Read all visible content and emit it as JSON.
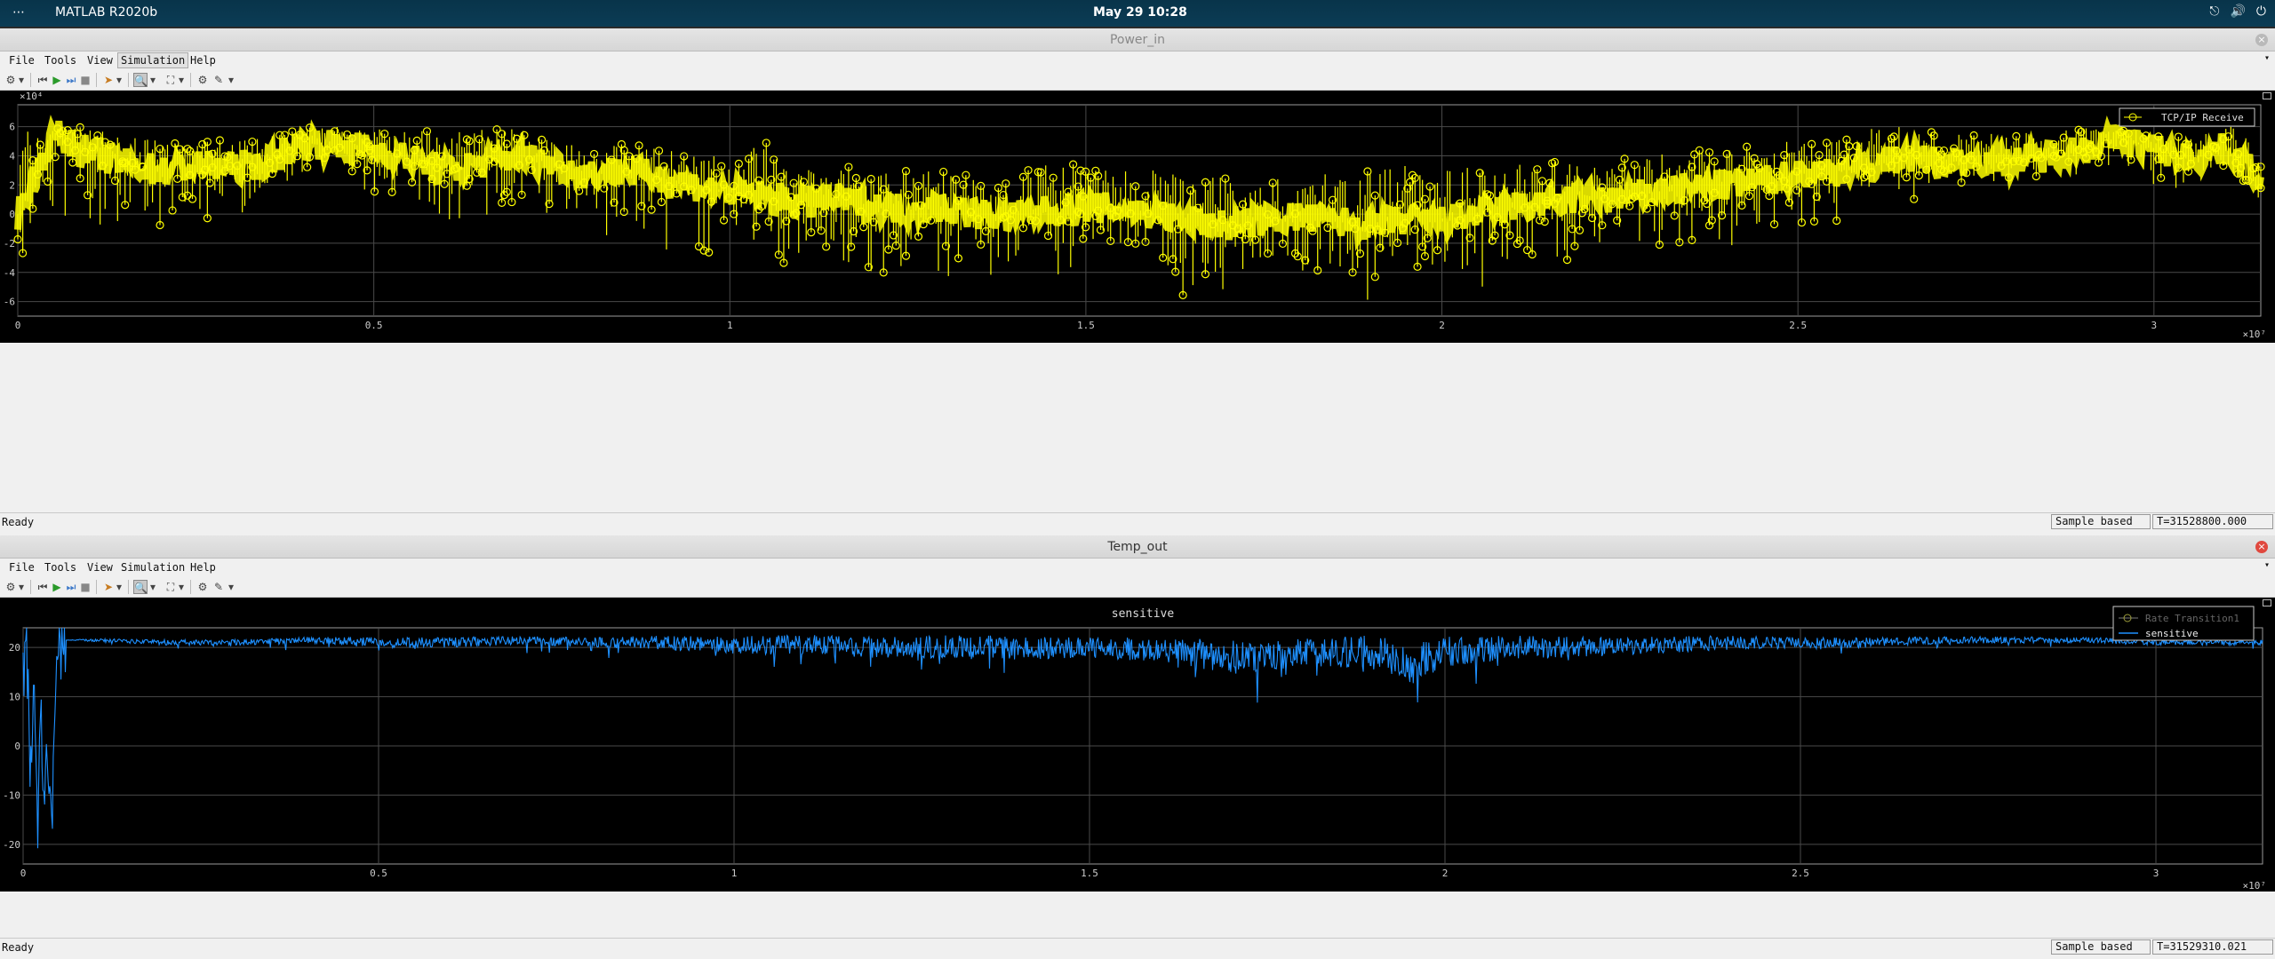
{
  "topbar": {
    "activities": "⋯",
    "app_name": "MATLAB R2020b",
    "clock": "May 29  10:28"
  },
  "scopes": [
    {
      "title": "Power_in",
      "menu": [
        "File",
        "Tools",
        "View",
        "Simulation",
        "Help"
      ],
      "status": {
        "ready": "Ready",
        "mode": "Sample based",
        "time": "T=31528800.000"
      }
    },
    {
      "title": "Temp_out",
      "plot_title": "sensitive",
      "menu": [
        "File",
        "Tools",
        "View",
        "Simulation",
        "Help"
      ],
      "status": {
        "ready": "Ready",
        "mode": "Sample based",
        "time": "T=31529310.021"
      }
    }
  ],
  "colors": {
    "signal_power": "#ffff00",
    "signal_temp": "#1e90ff",
    "axes_bg": "#000000",
    "grid": "#4a4a4a",
    "tick_text": "#cccccc"
  },
  "chart_data": [
    {
      "type": "scatter",
      "title": "",
      "xlabel": "",
      "ylabel": "",
      "x_exponent_label": "×10⁷",
      "y_exponent_label": "×10⁴",
      "xlim": [
        0,
        3.15
      ],
      "ylim": [
        -7,
        7.5
      ],
      "x_ticks": [
        "0",
        "0.5",
        "1",
        "1.5",
        "2",
        "2.5",
        "3"
      ],
      "x_tick_values": [
        0,
        0.5,
        1,
        1.5,
        2,
        2.5,
        3
      ],
      "y_ticks": [
        "6",
        "4",
        "2",
        "0",
        "-2",
        "-4",
        "-6"
      ],
      "y_tick_values": [
        6,
        4,
        2,
        0,
        -2,
        -4,
        -6
      ],
      "grid": true,
      "legend": {
        "position": "top-right",
        "entries": [
          "TCP/IP Receive"
        ]
      },
      "series": [
        {
          "name": "TCP/IP Receive",
          "marker": "circle",
          "x": [
            0,
            0.05,
            0.1,
            0.15,
            0.2,
            0.25,
            0.3,
            0.35,
            0.4,
            0.45,
            0.5,
            0.55,
            0.6,
            0.65,
            0.7,
            0.75,
            0.8,
            0.85,
            0.9,
            0.95,
            1.0,
            1.05,
            1.1,
            1.15,
            1.2,
            1.25,
            1.3,
            1.35,
            1.4,
            1.45,
            1.5,
            1.55,
            1.6,
            1.65,
            1.7,
            1.75,
            1.8,
            1.85,
            1.9,
            1.95,
            2.0,
            2.05,
            2.1,
            2.15,
            2.2,
            2.25,
            2.3,
            2.35,
            2.4,
            2.45,
            2.5,
            2.55,
            2.6,
            2.65,
            2.7,
            2.75,
            2.8,
            2.85,
            2.9,
            2.95,
            3.0,
            3.05,
            3.1,
            3.15
          ],
          "y": [
            0,
            5.5,
            4.2,
            3.5,
            3.0,
            3.3,
            3.2,
            3.5,
            5.0,
            4.6,
            4.5,
            3.8,
            3.0,
            3.5,
            4.0,
            3.5,
            2.8,
            3.0,
            2.5,
            2.0,
            1.5,
            1.2,
            0.8,
            1.0,
            0.6,
            0.3,
            0.5,
            0.0,
            -0.2,
            0.2,
            0.5,
            0.3,
            0.0,
            -0.5,
            -0.8,
            -0.4,
            -0.2,
            -0.5,
            -0.8,
            -0.4,
            -0.5,
            0.0,
            0.5,
            0.8,
            1.2,
            1.0,
            1.5,
            1.8,
            2.0,
            2.2,
            2.8,
            3.0,
            3.2,
            4.0,
            3.5,
            3.8,
            3.6,
            4.0,
            4.5,
            5.2,
            4.5,
            3.8,
            4.5,
            2.5
          ],
          "y_low": [
            -6.5,
            -2.0,
            -0.5,
            -1.5,
            -2.0,
            -1.0,
            -1.0,
            -0.5,
            2.5,
            0.5,
            -0.5,
            -1.5,
            -2.0,
            -1.0,
            -1.0,
            -1.5,
            -3.5,
            -2.0,
            -4.0,
            -3.5,
            -4.0,
            -4.0,
            -4.5,
            -4.0,
            -5.5,
            -5.0,
            -4.5,
            -6.0,
            -6.5,
            -5.5,
            -5.0,
            -5.5,
            -6.0,
            -6.5,
            -6.5,
            -6.0,
            -6.0,
            -6.5,
            -6.5,
            -6.0,
            -6.0,
            -5.5,
            -5.0,
            -4.5,
            -4.5,
            -4.0,
            -3.5,
            -3.5,
            -3.0,
            -2.5,
            -1.5,
            -1.0,
            0.0,
            0.0,
            1.5,
            1.5,
            2.0,
            2.0,
            2.5,
            3.0,
            2.0,
            1.5,
            2.0,
            1.0
          ],
          "y_high": [
            6.0,
            6.0,
            6.0,
            5.5,
            5.0,
            5.0,
            5.2,
            5.5,
            6.0,
            6.0,
            6.0,
            6.0,
            5.5,
            6.0,
            6.0,
            5.0,
            5.0,
            5.0,
            4.5,
            4.0,
            4.0,
            5.0,
            3.0,
            3.5,
            3.0,
            3.5,
            3.5,
            2.5,
            3.0,
            3.5,
            3.5,
            3.0,
            3.0,
            2.5,
            3.0,
            2.5,
            3.0,
            3.0,
            3.0,
            3.5,
            3.0,
            3.5,
            3.5,
            4.0,
            3.5,
            4.0,
            4.0,
            4.5,
            4.5,
            5.0,
            5.0,
            5.0,
            6.0,
            6.0,
            5.5,
            5.5,
            5.5,
            6.0,
            6.0,
            6.0,
            5.5,
            5.5,
            6.0,
            6.0
          ]
        }
      ]
    },
    {
      "type": "line",
      "title": "sensitive",
      "xlabel": "",
      "ylabel": "",
      "x_exponent_label": "×10⁷",
      "xlim": [
        0,
        3.15
      ],
      "ylim": [
        -24,
        24
      ],
      "x_ticks": [
        "0",
        "0.5",
        "1",
        "1.5",
        "2",
        "2.5",
        "3"
      ],
      "x_tick_values": [
        0,
        0.5,
        1,
        1.5,
        2,
        2.5,
        3
      ],
      "y_ticks": [
        "20",
        "10",
        "0",
        "-10",
        "-20"
      ],
      "y_tick_values": [
        20,
        10,
        0,
        -10,
        -20
      ],
      "grid": true,
      "legend": {
        "position": "top-right",
        "entries": [
          "Rate Transition1",
          "sensitive"
        ]
      },
      "series": [
        {
          "name": "sensitive",
          "x": [
            0,
            0.005,
            0.01,
            0.015,
            0.02,
            0.025,
            0.03,
            0.035,
            0.04,
            0.045,
            0.05,
            0.055,
            0.06,
            0.1,
            0.2,
            0.3,
            0.4,
            0.5,
            0.6,
            0.7,
            0.8,
            0.9,
            1.0,
            1.1,
            1.2,
            1.3,
            1.4,
            1.5,
            1.6,
            1.7,
            1.8,
            1.9,
            1.95,
            2.0,
            2.1,
            2.2,
            2.3,
            2.4,
            2.5,
            2.6,
            2.7,
            2.8,
            2.9,
            3.0,
            3.1,
            3.15
          ],
          "y": [
            15,
            20,
            -5,
            12,
            -18,
            5,
            -10,
            -2,
            -16,
            8,
            18,
            21,
            21.5,
            21.5,
            21,
            21,
            21.5,
            21,
            21,
            21.5,
            21,
            21,
            20.5,
            20.5,
            20,
            20,
            20,
            20,
            19.5,
            18,
            19,
            19,
            17,
            19,
            20,
            20,
            20.5,
            21,
            21,
            21,
            21.5,
            21.5,
            21.5,
            21,
            21,
            21
          ],
          "spread": [
            0,
            0,
            0,
            0,
            0,
            0,
            0,
            0,
            0,
            0,
            0,
            0,
            0,
            0.5,
            0.8,
            0.8,
            1.0,
            1.5,
            1.5,
            1.2,
            1.5,
            2.0,
            2.5,
            3.0,
            3.0,
            3.5,
            3.5,
            3.0,
            3.5,
            5.0,
            4.0,
            5.0,
            6.0,
            4.5,
            3.5,
            3.0,
            2.5,
            2.0,
            1.5,
            1.5,
            1.0,
            1.0,
            0.8,
            0.8,
            0.8,
            0.8
          ]
        }
      ]
    }
  ]
}
